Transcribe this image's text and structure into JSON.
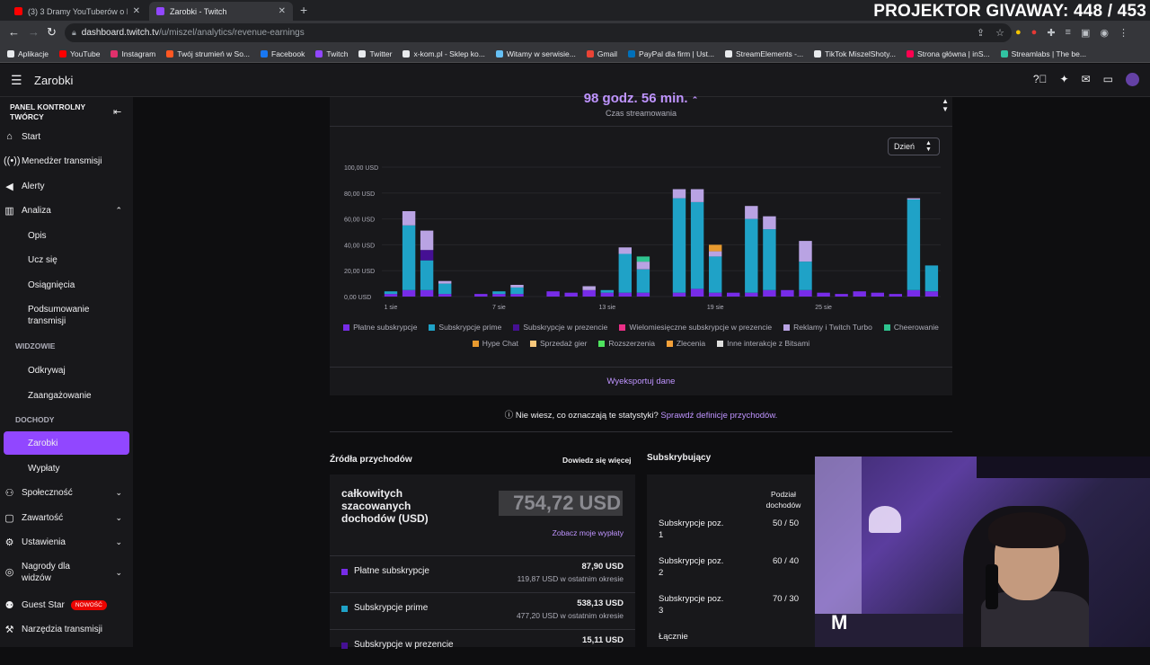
{
  "browser": {
    "tabs": [
      {
        "title": "(3) 3 Dramy YouTuberów o Których",
        "favicon_color": "#ff0000"
      },
      {
        "title": "Zarobki - Twitch",
        "favicon_color": "#9147ff"
      }
    ],
    "url_host": "dashboard.twitch.tv",
    "url_path": "/u/miszel/analytics/revenue-earnings",
    "bookmarks": [
      {
        "label": "Aplikacje",
        "color": "#e8eaed"
      },
      {
        "label": "YouTube",
        "color": "#ff0000"
      },
      {
        "label": "Instagram",
        "color": "#e1306c"
      },
      {
        "label": "Twój strumień w So...",
        "color": "#ff5722"
      },
      {
        "label": "Facebook",
        "color": "#1877f2"
      },
      {
        "label": "Twitch",
        "color": "#9147ff"
      },
      {
        "label": "Twitter",
        "color": "#e8eaed"
      },
      {
        "label": "x-kom.pl - Sklep ko...",
        "color": "#e8eaed"
      },
      {
        "label": "Witamy w serwisie...",
        "color": "#66c0f4"
      },
      {
        "label": "Gmail",
        "color": "#ea4335"
      },
      {
        "label": "PayPal dla firm | Ust...",
        "color": "#0070ba"
      },
      {
        "label": "StreamElements -...",
        "color": "#e8eaed"
      },
      {
        "label": "TikTok MiszelShoty...",
        "color": "#e8eaed"
      },
      {
        "label": "Strona główna | inS...",
        "color": "#ff0050"
      },
      {
        "label": "Streamlabs | The be...",
        "color": "#31c3a2"
      }
    ]
  },
  "overlay": {
    "title": "PROJEKTOR GIVAWAY: 448 / 453"
  },
  "topnav": {
    "page_title": "Zarobki"
  },
  "sidebar": {
    "header": "PANEL KONTROLNY TWÓRCY",
    "items": {
      "start": "Start",
      "manager": "Menedżer transmisji",
      "alerts": "Alerty",
      "analytics": "Analiza",
      "community": "Społeczność",
      "content": "Zawartość",
      "settings": "Ustawienia",
      "rewards": "Nagrody dla widzów",
      "guest_star": "Guest Star",
      "tools": "Narzędzia transmisji"
    },
    "analytics_sub": {
      "overview": "Opis",
      "learn": "Ucz się",
      "achievements": "Osiągnięcia",
      "summary": "Podsumowanie transmisji"
    },
    "sections": {
      "viewers": "WIDZOWIE",
      "revenue": "DOCHODY"
    },
    "viewers_sub": {
      "discover": "Odkrywaj",
      "engagement": "Zaangażowanie"
    },
    "revenue_sub": {
      "earnings": "Zarobki",
      "payouts": "Wypłaty"
    },
    "new_badge": "NOWOŚĆ"
  },
  "stats": {
    "stream_time_value": "98 godz. 56 min.",
    "stream_time_label": "Czas streamowania"
  },
  "period_select": {
    "value": "Dzień"
  },
  "chart_data": {
    "type": "bar",
    "stacked": true,
    "y_tick_labels": [
      "0,00 USD",
      "20,00 USD",
      "40,00 USD",
      "60,00 USD",
      "80,00 USD",
      "100,00 USD"
    ],
    "ylim": [
      0,
      100
    ],
    "x_tick_labels": [
      {
        "index": 0,
        "label": "1 sie"
      },
      {
        "index": 6,
        "label": "7 sie"
      },
      {
        "index": 12,
        "label": "13 sie"
      },
      {
        "index": 18,
        "label": "19 sie"
      },
      {
        "index": 24,
        "label": "25 sie"
      }
    ],
    "grid": true,
    "series": [
      {
        "name": "Płatne subskrypcje",
        "color": "#772ce8",
        "values": [
          2,
          5,
          5,
          2,
          0,
          2,
          2,
          2,
          0,
          4,
          3,
          5,
          3,
          3,
          3,
          0,
          3,
          6,
          3,
          3,
          3,
          5,
          5,
          5,
          3,
          2,
          4,
          3,
          2,
          5,
          4
        ]
      },
      {
        "name": "Subskrypcje prime",
        "color": "#1fa2c7",
        "values": [
          2,
          50,
          23,
          8,
          0,
          0,
          2,
          5,
          0,
          0,
          0,
          0,
          2,
          30,
          18,
          0,
          73,
          67,
          28,
          0,
          57,
          47,
          0,
          22,
          0,
          0,
          0,
          0,
          0,
          70,
          20
        ]
      },
      {
        "name": "Subskrypcje w prezencie",
        "color": "#451093",
        "values": [
          0,
          0,
          8,
          0,
          0,
          0,
          0,
          0,
          0,
          0,
          0,
          0,
          0,
          0,
          0,
          0,
          0,
          0,
          0,
          0,
          0,
          0,
          0,
          0,
          0,
          0,
          0,
          0,
          0,
          0,
          0
        ]
      },
      {
        "name": "Wielomiesięczne subskrypcje w prezencie",
        "color": "#ea2f87",
        "values": [
          0,
          0,
          0,
          0,
          0,
          0,
          0,
          0,
          0,
          0,
          0,
          0,
          0,
          0,
          0,
          0,
          0,
          0,
          0,
          0,
          0,
          0,
          0,
          0,
          0,
          0,
          0,
          0,
          0,
          0,
          0
        ]
      },
      {
        "name": "Reklamy i Twitch Turbo",
        "color": "#b9a3e3",
        "values": [
          0,
          11,
          15,
          2,
          0,
          0,
          0,
          2,
          0,
          0,
          0,
          3,
          0,
          5,
          6,
          0,
          7,
          10,
          4,
          0,
          10,
          10,
          0,
          16,
          0,
          0,
          0,
          0,
          0,
          1,
          0
        ]
      },
      {
        "name": "Cheerowanie",
        "color": "#2ec48f",
        "values": [
          0,
          0,
          0,
          0,
          0,
          0,
          0,
          0,
          0,
          0,
          0,
          0,
          0,
          0,
          4,
          0,
          0,
          0,
          0,
          0,
          0,
          0,
          0,
          0,
          0,
          0,
          0,
          0,
          0,
          0,
          0
        ]
      },
      {
        "name": "Hype Chat",
        "color": "#e89a2f",
        "values": [
          0,
          0,
          0,
          0,
          0,
          0,
          0,
          0,
          0,
          0,
          0,
          0,
          0,
          0,
          0,
          0,
          0,
          0,
          5,
          0,
          0,
          0,
          0,
          0,
          0,
          0,
          0,
          0,
          0,
          0,
          0
        ]
      },
      {
        "name": "Sprzedaż gier",
        "color": "#f8c77b",
        "values": [
          0,
          0,
          0,
          0,
          0,
          0,
          0,
          0,
          0,
          0,
          0,
          0,
          0,
          0,
          0,
          0,
          0,
          0,
          0,
          0,
          0,
          0,
          0,
          0,
          0,
          0,
          0,
          0,
          0,
          0,
          0
        ]
      },
      {
        "name": "Rozszerzenia",
        "color": "#4ee35e",
        "values": [
          0,
          0,
          0,
          0,
          0,
          0,
          0,
          0,
          0,
          0,
          0,
          0,
          0,
          0,
          0,
          0,
          0,
          0,
          0,
          0,
          0,
          0,
          0,
          0,
          0,
          0,
          0,
          0,
          0,
          0,
          0
        ]
      },
      {
        "name": "Zlecenia",
        "color": "#f5a13a",
        "values": [
          0,
          0,
          0,
          0,
          0,
          0,
          0,
          0,
          0,
          0,
          0,
          0,
          0,
          0,
          0,
          0,
          0,
          0,
          0,
          0,
          0,
          0,
          0,
          0,
          0,
          0,
          0,
          0,
          0,
          0,
          0
        ]
      },
      {
        "name": "Inne interakcje z Bitsami",
        "color": "#dedede",
        "values": [
          0,
          0,
          0,
          0,
          0,
          0,
          0,
          0,
          0,
          0,
          0,
          0,
          0,
          0,
          0,
          0,
          0,
          0,
          0,
          0,
          0,
          0,
          0,
          0,
          0,
          0,
          0,
          0,
          0,
          0,
          0
        ]
      }
    ]
  },
  "export_label": "Wyeksportuj dane",
  "help": {
    "question": "Nie wiesz, co oznaczają te statystyki?",
    "link": "Sprawdź definicje przychodów."
  },
  "revenue_sources": {
    "title": "Źródła przychodów",
    "learn_more": "Dowiedz się więcej",
    "total_label": "całkowitych szacowanych dochodów (USD)",
    "total_value": "754,72 USD",
    "payouts_link": "Zobacz moje wypłaty",
    "rows": [
      {
        "name": "Płatne subskrypcje",
        "value": "87,90 USD",
        "previous": "119,87 USD w ostatnim okresie",
        "color": "#772ce8"
      },
      {
        "name": "Subskrypcje prime",
        "value": "538,13 USD",
        "previous": "477,20 USD w ostatnim okresie",
        "color": "#1fa2c7"
      },
      {
        "name": "Subskrypcje w prezencie",
        "value": "15,11 USD",
        "previous": "",
        "color": "#451093"
      }
    ]
  },
  "subscribers": {
    "title": "Subskrybujący",
    "split_header": "Podział dochodów",
    "rows": [
      {
        "label": "Subskrypcje poz. 1",
        "ratio": "50 / 50"
      },
      {
        "label": "Subskrypcje poz. 2",
        "ratio": "60 / 40"
      },
      {
        "label": "Subskrypcje poz. 3",
        "ratio": "70 / 30"
      },
      {
        "label": "Łącznie",
        "ratio": ""
      }
    ]
  }
}
